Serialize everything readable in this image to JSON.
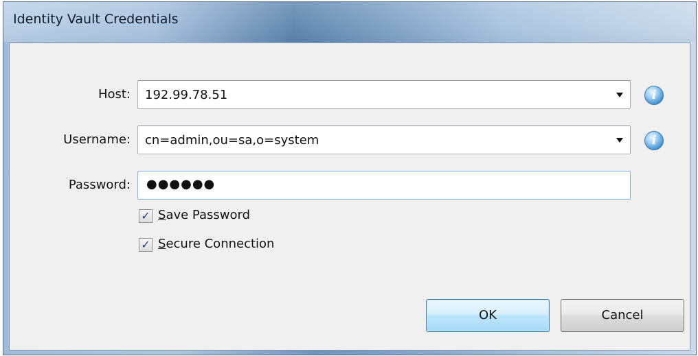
{
  "window": {
    "title": "Identity Vault Credentials"
  },
  "form": {
    "host": {
      "label": "Host:",
      "value": "192.99.78.51"
    },
    "username": {
      "label": "Username:",
      "value": "cn=admin,ou=sa,o=system"
    },
    "password": {
      "label": "Password:",
      "value": "●●●●●●"
    },
    "info_glyph": "i"
  },
  "options": {
    "save_password": {
      "mnemonic": "S",
      "rest": "ave Password",
      "checked": true,
      "mark": "✓"
    },
    "secure_connection": {
      "mnemonic": "S",
      "rest": "ecure Connection",
      "checked": true,
      "mark": "✓"
    }
  },
  "buttons": {
    "ok": "OK",
    "cancel": "Cancel"
  },
  "icons": {
    "info": "info-icon",
    "dropdown": "chevron-down-icon",
    "check": "check-icon"
  }
}
